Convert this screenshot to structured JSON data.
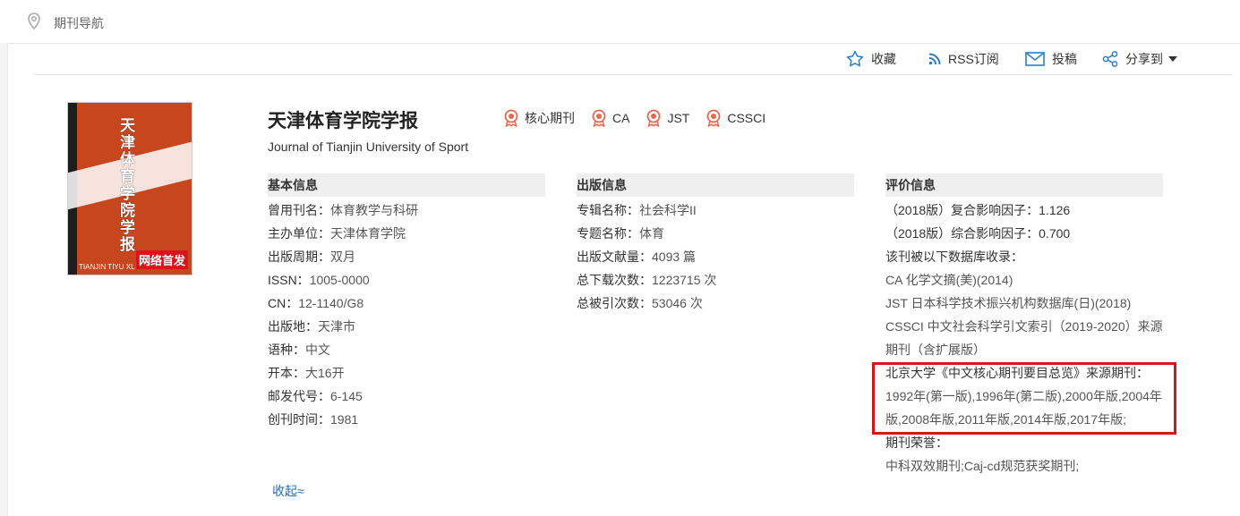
{
  "breadcrumb": {
    "label": "期刊导航"
  },
  "toolbar": {
    "favorite": "收藏",
    "rss": "RSS订阅",
    "submit": "投稿",
    "share": "分享到"
  },
  "cover": {
    "vertical_title": "天津体育学院学报",
    "badge": "网络首发",
    "bottom_text": "TIANJIN TIYU XL"
  },
  "journal": {
    "title": "天津体育学院学报",
    "subtitle": "Journal of Tianjin University of Sport",
    "tags": [
      "核心期刊",
      "CA",
      "JST",
      "CSSCI"
    ]
  },
  "basic": {
    "header": "基本信息",
    "rows": [
      {
        "label": "曾用刊名：",
        "value": "体育教学与科研"
      },
      {
        "label": "主办单位：",
        "value": "天津体育学院"
      },
      {
        "label": "出版周期：",
        "value": "双月"
      },
      {
        "label": "ISSN：",
        "value": "1005-0000"
      },
      {
        "label": "CN：",
        "value": "12-1140/G8"
      },
      {
        "label": "出版地：",
        "value": "天津市"
      },
      {
        "label": "语种：",
        "value": "中文"
      },
      {
        "label": "开本：",
        "value": "大16开"
      },
      {
        "label": "邮发代号：",
        "value": "6-145"
      },
      {
        "label": "创刊时间：",
        "value": "1981"
      }
    ]
  },
  "publish": {
    "header": "出版信息",
    "rows": [
      {
        "label": "专辑名称：",
        "value": "社会科学II"
      },
      {
        "label": "专题名称：",
        "value": "体育"
      },
      {
        "label": "出版文献量：",
        "value": "4093 篇"
      },
      {
        "label": "总下载次数：",
        "value": "1223715 次"
      },
      {
        "label": "总被引次数：",
        "value": "53046 次"
      }
    ]
  },
  "evaluation": {
    "header": "评价信息",
    "lines": [
      {
        "text": "（2018版）复合影响因子：1.126"
      },
      {
        "text": "（2018版）综合影响因子：0.700"
      },
      {
        "text": "该刊被以下数据库收录："
      },
      {
        "text": "CA 化学文摘(美)(2014)"
      },
      {
        "text": "JST 日本科学技术振兴机构数据库(日)(2018)"
      },
      {
        "text": "CSSCI 中文社会科学引文索引（2019-2020）来源"
      },
      {
        "text": "期刊（含扩展版）"
      },
      {
        "text": "北京大学《中文核心期刊要目总览》来源期刊："
      },
      {
        "text": "1992年(第一版),1996年(第二版),2000年版,2004年"
      },
      {
        "text": "版,2008年版,2011年版,2014年版,2017年版;"
      },
      {
        "text": "期刊荣誉："
      },
      {
        "text": "中科双效期刊;Caj-cd规范获奖期刊;"
      }
    ]
  },
  "collapse_label": "收起≈",
  "colors": {
    "highlight_box": "#d9141c",
    "link": "#1e6fb5",
    "accent_icon": "#e8674f"
  }
}
